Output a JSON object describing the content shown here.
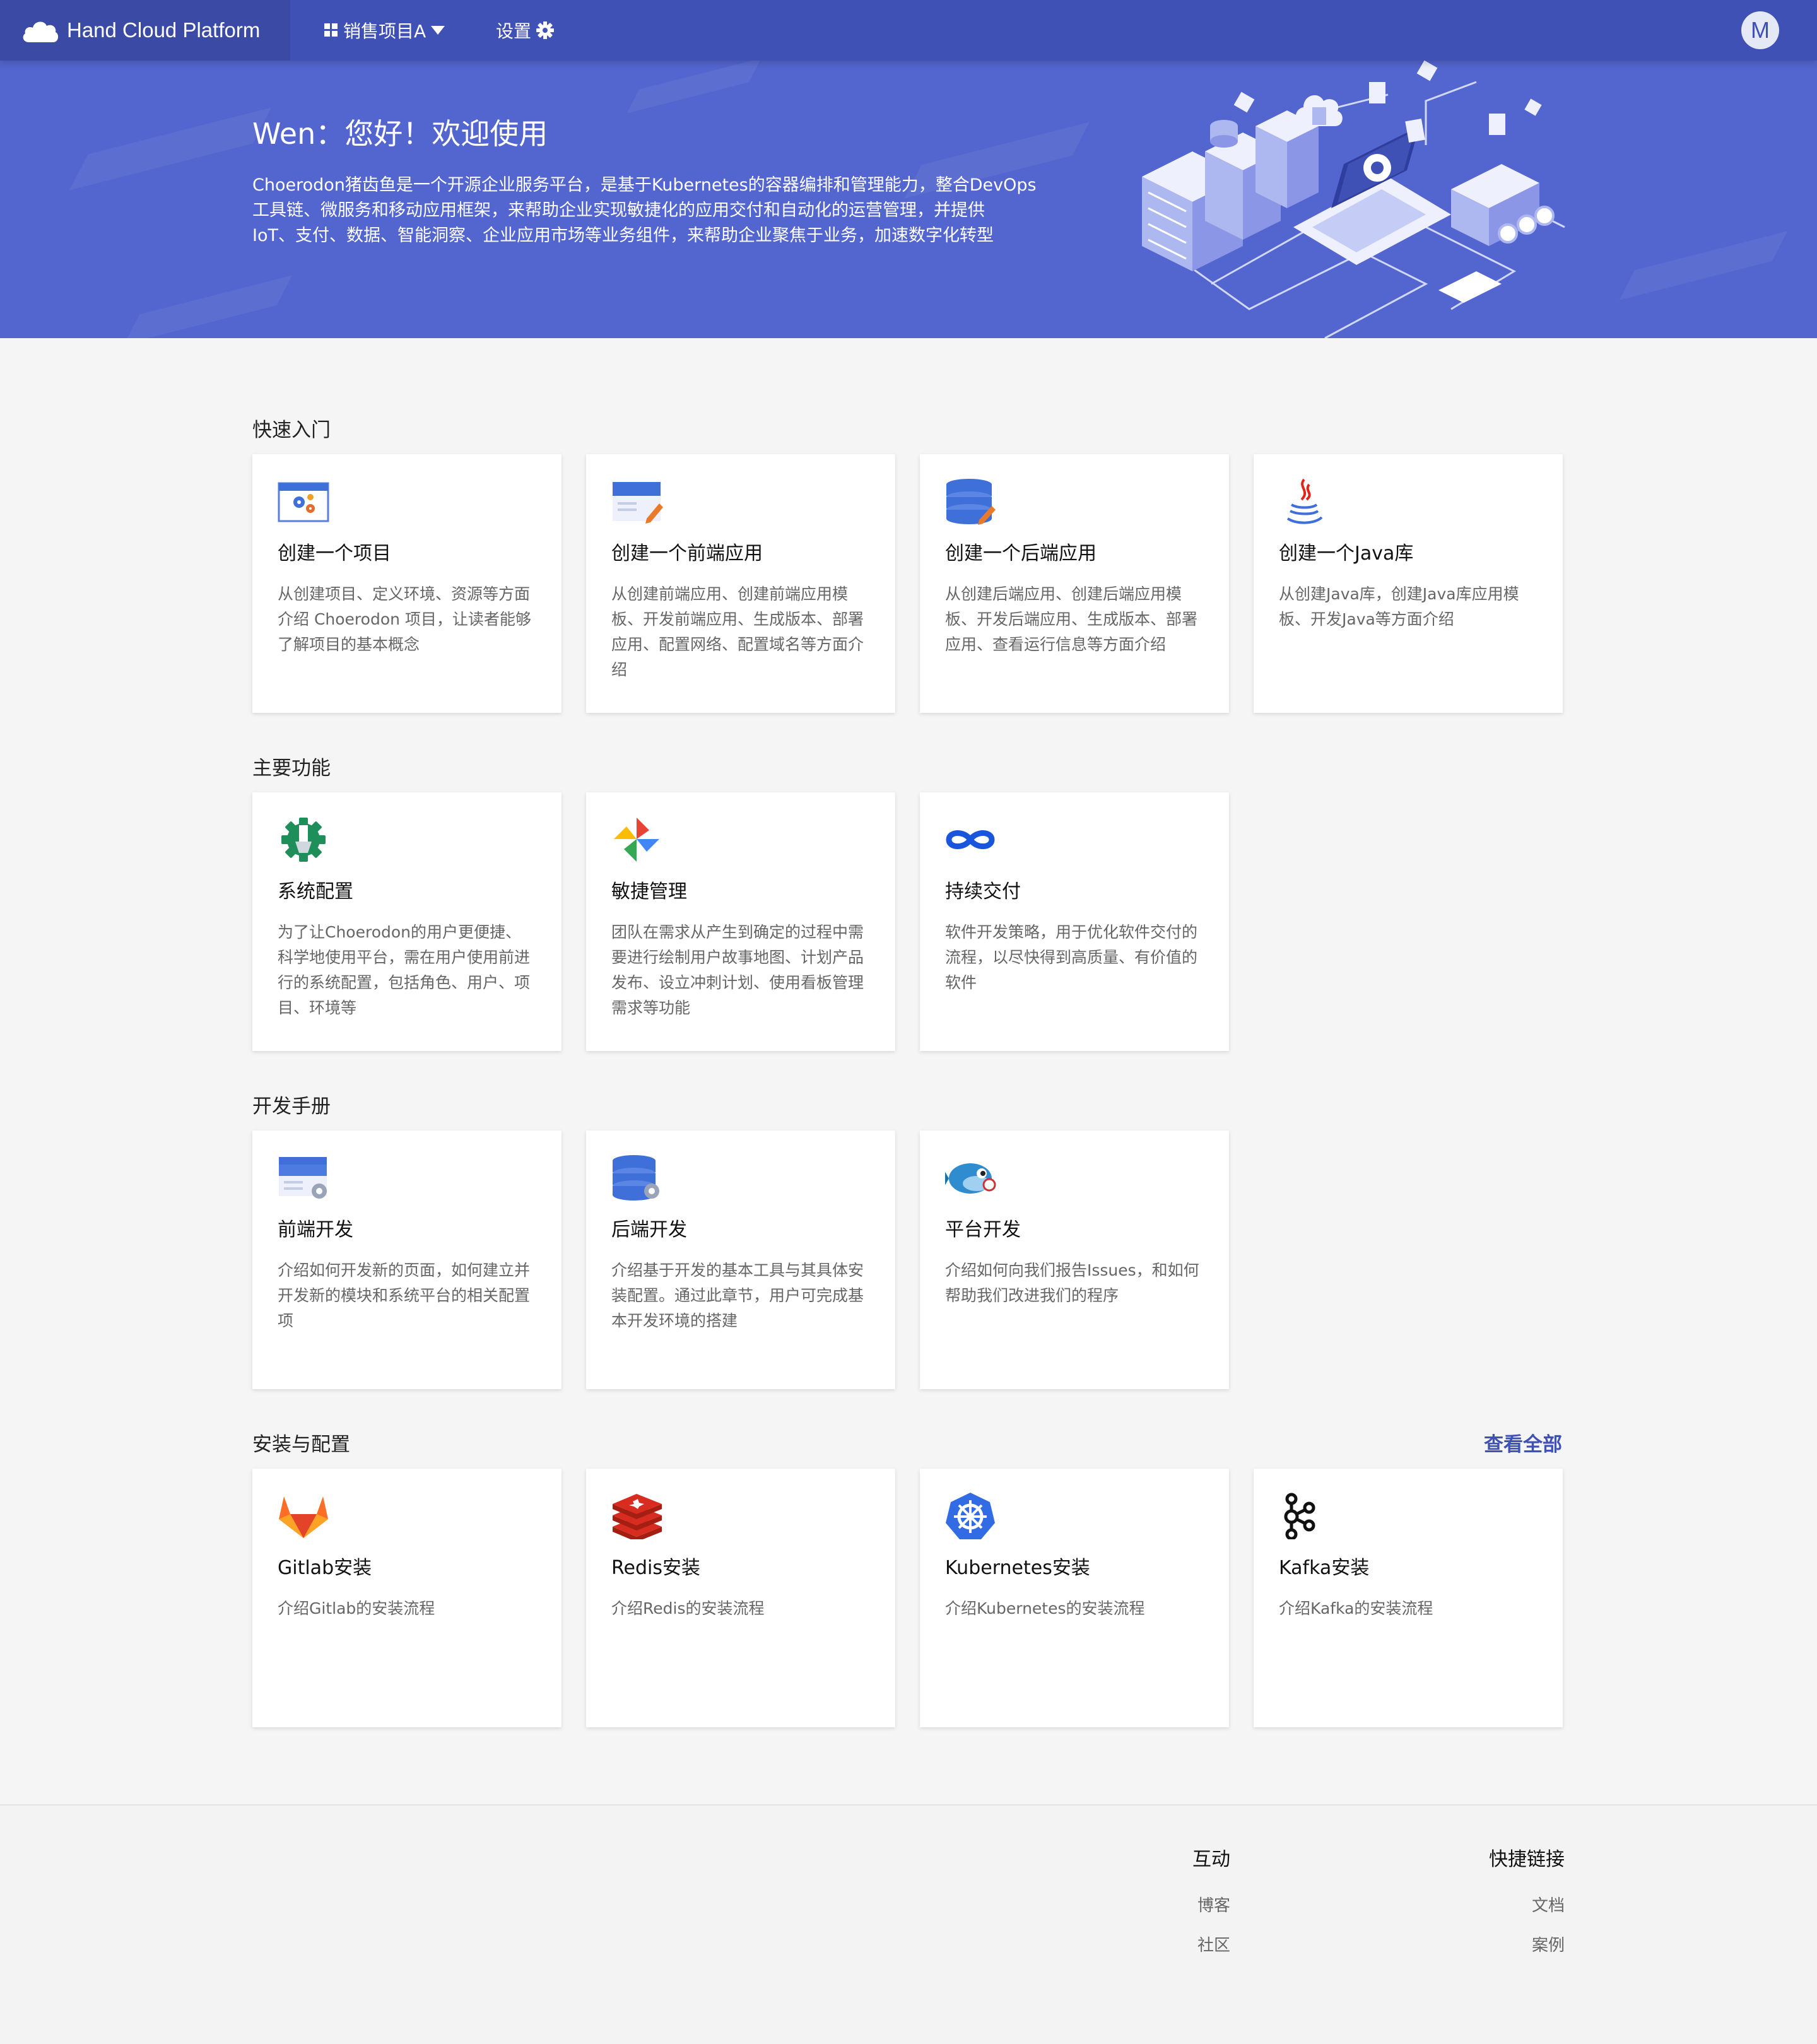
{
  "topbar": {
    "brand": "Hand Cloud Platform",
    "project_label": "销售项目A",
    "settings_label": "设置",
    "avatar_initial": "M"
  },
  "banner": {
    "title": "Wen：您好！欢迎使用",
    "desc_lines": [
      "Choerodon猪齿鱼是一个开源企业服务平台，是基于Kubernetes的容器编排和管理能力，整合DevOps",
      "工具链、微服务和移动应用框架，来帮助企业实现敏捷化的应用交付和自动化的运营管理，并提供",
      "IoT、支付、数据、智能洞察、企业应用市场等业务组件，来帮助企业聚焦于业务，加速数字化转型"
    ]
  },
  "sections": {
    "quick_start": {
      "title": "快速入门",
      "cards": [
        {
          "title": "创建一个项目",
          "desc": "从创建项目、定义环境、资源等方面介绍 Choerodon 项目，让读者能够了解项目的基本概念",
          "icon": "project-settings-icon"
        },
        {
          "title": "创建一个前端应用",
          "desc": "从创建前端应用、创建前端应用模板、开发前端应用、生成版本、部署应用、配置网络、配置域名等方面介绍",
          "icon": "frontend-edit-icon"
        },
        {
          "title": "创建一个后端应用",
          "desc": "从创建后端应用、创建后端应用模板、开发后端应用、生成版本、部署应用、查看运行信息等方面介绍",
          "icon": "database-edit-icon"
        },
        {
          "title": "创建一个Java库",
          "desc": "从创建Java库，创建Java库应用模板、开发Java等方面介绍",
          "icon": "java-icon"
        }
      ]
    },
    "main_features": {
      "title": "主要功能",
      "cards": [
        {
          "title": "系统配置",
          "desc": "为了让Choerodon的用户更便捷、科学地使用平台，需在用户使用前进行的系统配置，包括角色、用户、项目、环境等",
          "icon": "gear-icon"
        },
        {
          "title": "敏捷管理",
          "desc": "团队在需求从产生到确定的过程中需要进行绘制用户故事地图、计划产品发布、设立冲刺计划、使用看板管理需求等功能",
          "icon": "pinwheel-icon"
        },
        {
          "title": "持续交付",
          "desc": "软件开发策略，用于优化软件交付的流程，以尽快得到高质量、有价值的软件",
          "icon": "infinity-icon"
        }
      ]
    },
    "dev_manual": {
      "title": "开发手册",
      "cards": [
        {
          "title": "前端开发",
          "desc": "介绍如何开发新的页面，如何建立并开发新的模块和系统平台的相关配置项",
          "icon": "browser-gear-icon"
        },
        {
          "title": "后端开发",
          "desc": "介绍基于开发的基本工具与其具体安装配置。通过此章节，用户可完成基本开发环境的搭建",
          "icon": "database-gear-icon"
        },
        {
          "title": "平台开发",
          "desc": "介绍如何向我们报告Issues，和如何帮助我们改进我们的程序",
          "icon": "fish-icon"
        }
      ]
    },
    "install": {
      "title": "安装与配置",
      "view_all": "查看全部",
      "cards": [
        {
          "title": "Gitlab安装",
          "desc": "介绍Gitlab的安装流程",
          "icon": "gitlab-icon"
        },
        {
          "title": "Redis安装",
          "desc": "介绍Redis的安装流程",
          "icon": "redis-icon"
        },
        {
          "title": "Kubernetes安装",
          "desc": "介绍Kubernetes的安装流程",
          "icon": "kubernetes-icon"
        },
        {
          "title": "Kafka安装",
          "desc": "介绍Kafka的安装流程",
          "icon": "kafka-icon"
        }
      ]
    }
  },
  "footer": {
    "interact": {
      "title": "互动",
      "links": [
        "博客",
        "社区"
      ]
    },
    "quick_links": {
      "title": "快捷链接",
      "links": [
        "文档",
        "案例"
      ]
    }
  },
  "colors": {
    "primary": "#3f51b5",
    "banner": "#5365cf",
    "page_bg": "#f5f5f5"
  }
}
